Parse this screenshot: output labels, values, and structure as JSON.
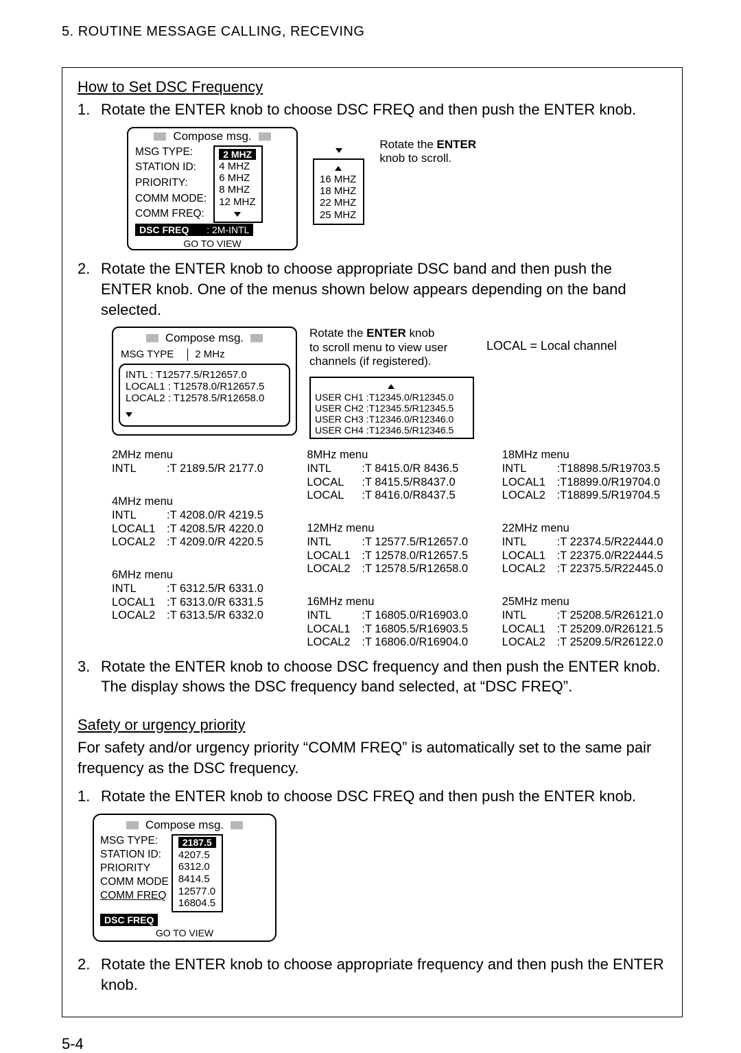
{
  "header": "5. ROUTINE MESSAGE CALLING, RECEVING",
  "section_title": "How to Set DSC Frequency",
  "steps": {
    "a1_no": "1.",
    "a1": "Rotate the ENTER knob to choose DSC FREQ and then push the ENTER knob.",
    "a2_no": "2.",
    "a2": "Rotate the ENTER knob to choose appropriate DSC band and then push the ENTER knob. One of the menus shown below appears depending on the band selected.",
    "a3_no": "3.",
    "a3": "Rotate the ENTER knob to choose DSC frequency and then push the ENTER knob. The display shows the DSC frequency band selected, at “DSC FREQ”.",
    "b1_no": "1.",
    "b1": "Rotate the ENTER knob to choose DSC FREQ and then push the ENTER knob.",
    "b2_no": "2.",
    "b2": "Rotate the ENTER knob to choose appropriate frequency and then push the ENTER knob."
  },
  "fig1": {
    "compose": "Compose msg.",
    "labels": [
      "MSG TYPE:",
      "STATION ID:",
      "PRIORITY:",
      "COMM MODE:",
      "COMM FREQ:"
    ],
    "sel_label": "DSC FREQ",
    "sel_val": ": 2M-INTL",
    "popup": [
      "2 MHZ",
      "4 MHZ",
      "6 MHZ",
      "8 MHZ",
      "12 MHZ"
    ],
    "popup2": [
      "16 MHZ",
      "18 MHZ",
      "22 MHZ",
      "25 MHZ"
    ],
    "goto": "GO TO VIEW",
    "note_l1_a": "Rotate the ",
    "note_l1_b": "ENTER",
    "note_l2": "knob to scroll."
  },
  "fig2": {
    "compose": "Compose msg.",
    "bar_l": "MSG TYPE",
    "bar_r": "2 MHz",
    "lines": [
      "INTL        : T12577.5/R12657.0",
      "LOCAL1   : T12578.0/R12657.5",
      "LOCAL2   : T12578.5/R12658.0"
    ],
    "note_l1_a": "Rotate the ",
    "note_l1_b": "ENTER",
    "note_l1_c": " knob",
    "note_l2": "to scroll menu to view user",
    "note_l3": "channels (if registered).",
    "local_note": "LOCAL = Local channel",
    "userbox": [
      "USER CH1 :T12345.0/R12345.0",
      "USER CH2 :T12345.5/R12345.5",
      "USER CH3 :T12346.0/R12346.0",
      "USER CH4 :T12346.5/R12346.5"
    ]
  },
  "menus": {
    "col1": [
      {
        "title": "2MHz menu",
        "rows": [
          [
            "INTL",
            ":T  2189.5/R 2177.0"
          ]
        ]
      },
      {
        "title": "4MHz menu",
        "rows": [
          [
            "INTL",
            ":T  4208.0/R 4219.5"
          ],
          [
            "LOCAL1",
            ":T  4208.5/R 4220.0"
          ],
          [
            "LOCAL2",
            ":T  4209.0/R 4220.5"
          ]
        ]
      },
      {
        "title": "6MHz menu",
        "rows": [
          [
            "INTL",
            ":T  6312.5/R 6331.0"
          ],
          [
            "LOCAL1",
            ":T  6313.0/R 6331.5"
          ],
          [
            "LOCAL2",
            ":T  6313.5/R 6332.0"
          ]
        ]
      }
    ],
    "col2": [
      {
        "title": "8MHz menu",
        "rows": [
          [
            "INTL",
            ":T  8415.0/R 8436.5"
          ],
          [
            "LOCAL",
            ":T  8415.5/R8437.0"
          ],
          [
            "LOCAL",
            ":T  8416.0/R8437.5"
          ]
        ]
      },
      {
        "title": "12MHz menu",
        "rows": [
          [
            "INTL",
            ":T 12577.5/R12657.0"
          ],
          [
            "LOCAL1",
            ":T 12578.0/R12657.5"
          ],
          [
            "LOCAL2",
            ":T 12578.5/R12658.0"
          ]
        ]
      },
      {
        "title": "16MHz menu",
        "rows": [
          [
            "INTL",
            ":T 16805.0/R16903.0"
          ],
          [
            "LOCAL1",
            ":T 16805.5/R16903.5"
          ],
          [
            "LOCAL2",
            ":T 16806.0/R16904.0"
          ]
        ]
      }
    ],
    "col3": [
      {
        "title": "18MHz menu",
        "rows": [
          [
            "INTL",
            ":T18898.5/R19703.5"
          ],
          [
            "LOCAL1",
            ":T18899.0/R19704.0"
          ],
          [
            "LOCAL2",
            ":T18899.5/R19704.5"
          ]
        ]
      },
      {
        "title": "22MHz menu",
        "rows": [
          [
            "INTL",
            ":T 22374.5/R22444.0"
          ],
          [
            "LOCAL1",
            ":T 22375.0/R22444.5"
          ],
          [
            "LOCAL2",
            ":T 22375.5/R22445.0"
          ]
        ]
      },
      {
        "title": "25MHz menu",
        "rows": [
          [
            "INTL",
            ":T 25208.5/R26121.0"
          ],
          [
            "LOCAL1",
            ":T 25209.0/R26121.5"
          ],
          [
            "LOCAL2",
            ":T 25209.5/R26122.0"
          ]
        ]
      }
    ]
  },
  "safety": {
    "title": "Safety or urgency priority",
    "intro": "For safety and/or urgency priority “COMM FREQ” is automatically set to the same pair frequency as the DSC frequency."
  },
  "fig3": {
    "compose": "Compose msg.",
    "labels": [
      "MSG TYPE:",
      "STATION ID:",
      "PRIORITY",
      "COMM MODE",
      "COMM FREQ"
    ],
    "popup": [
      "2187.5",
      "4207.5",
      "6312.0",
      "8414.5",
      "12577.0",
      "16804.5"
    ],
    "sel": "DSC FREQ",
    "goto": "GO TO VIEW"
  },
  "pageno": "5-4"
}
